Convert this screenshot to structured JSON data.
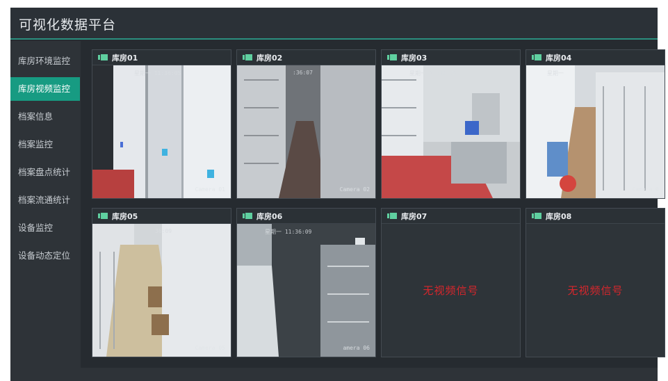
{
  "header": {
    "title": "可视化数据平台"
  },
  "sidebar": {
    "items": [
      {
        "label": "库房环境监控",
        "active": false
      },
      {
        "label": "库房视频监控",
        "active": true
      },
      {
        "label": "档案信息",
        "active": false
      },
      {
        "label": "档案监控",
        "active": false
      },
      {
        "label": "档案盘点统计",
        "active": false
      },
      {
        "label": "档案流通统计",
        "active": false
      },
      {
        "label": "设备监控",
        "active": false
      },
      {
        "label": "设备动态定位",
        "active": false
      }
    ]
  },
  "colors": {
    "accent": "#179b82",
    "header_line": "#2b8f7e",
    "no_signal": "#d8262c"
  },
  "cameras": [
    {
      "title": "库房01",
      "status": "video",
      "time": "星期一 11:36:05",
      "label": "Camera 01"
    },
    {
      "title": "库房02",
      "status": "video",
      "time": ":36:07",
      "label": "Camera 02"
    },
    {
      "title": "库房03",
      "status": "video",
      "time": "星期一 11:36:09",
      "label": ""
    },
    {
      "title": "库房04",
      "status": "video",
      "time": "星期一",
      "label": "Camera 0"
    },
    {
      "title": "库房05",
      "status": "video",
      "time": "36:09",
      "label": "Camera 05"
    },
    {
      "title": "库房06",
      "status": "video",
      "time": "星期一 11:36:09",
      "label": "amera 06"
    },
    {
      "title": "库房07",
      "status": "no_signal",
      "message": "无视频信号"
    },
    {
      "title": "库房08",
      "status": "no_signal",
      "message": "无视频信号"
    }
  ]
}
